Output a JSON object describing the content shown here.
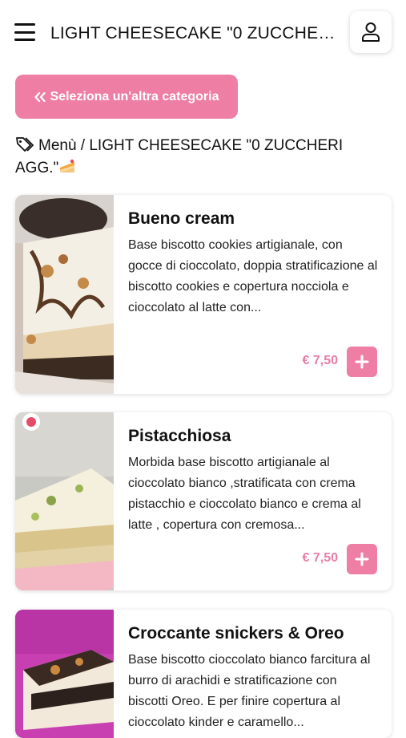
{
  "header": {
    "title": "LIGHT CHEESECAKE \"0 ZUCCHERI AGG.\"",
    "menu_icon": "hamburger-icon",
    "user_icon": "user-icon"
  },
  "back_button": {
    "icon": "double-chevron-left-icon",
    "label": "Seleziona un'altra categoria"
  },
  "breadcrumb": {
    "icon": "tags-icon",
    "text": "Menù / LIGHT CHEESECAKE \"0 ZUCCHERI AGG.\"",
    "suffix_icon": "cake-slice-icon"
  },
  "colors": {
    "accent": "#ee7ea3",
    "price": "#e77ea6"
  },
  "products": [
    {
      "name": "Bueno cream",
      "description": "Base biscotto cookies artigianale, con gocce di cioccolato, doppia stratificazione al biscotto cookies e copertura nocciola e cioccolato al latte con...",
      "price": "€ 7,50",
      "image": "cheesecake-photo"
    },
    {
      "name": "Pistacchiosa",
      "description": "Morbida base biscotto artigianale al cioccolato bianco ,stratificata con crema pistacchio e cioccolato bianco e crema al latte , copertura con cremosa...",
      "price": "€ 7,50",
      "image": "cheesecake-photo"
    },
    {
      "name": "Croccante snickers & Oreo",
      "description": "Base biscotto cioccolato bianco farcitura al burro di arachidi e stratificazione con biscotti Oreo. E per finire copertura al cioccolato kinder e caramello...",
      "price": "",
      "image": "cheesecake-photo"
    }
  ]
}
